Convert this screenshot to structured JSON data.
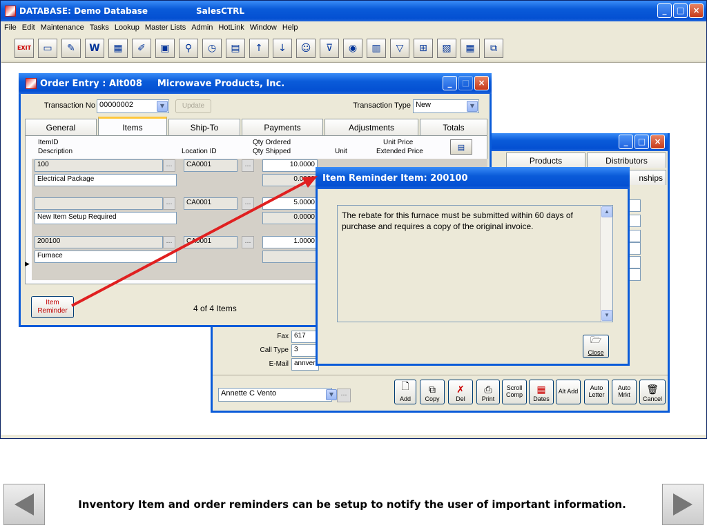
{
  "app": {
    "title_prefix": "DATABASE:",
    "db_name": "Demo Database",
    "product": "SalesCTRL"
  },
  "menu": [
    "File",
    "Edit",
    "Maintenance",
    "Tasks",
    "Lookup",
    "Master Lists",
    "Admin",
    "HotLink",
    "Window",
    "Help"
  ],
  "toolbar_exit_label": "EXIT",
  "customer_window": {
    "tabs": [
      "Products",
      "Distributors"
    ],
    "subtab_fragment": "nships",
    "fax_label": "Fax",
    "fax_value": "617",
    "calltype_label": "Call Type",
    "calltype_value": "3",
    "email_label": "E-Mail",
    "email_value": "annver",
    "contact_value": "Annette C Vento",
    "buttons": [
      {
        "name": "add",
        "label": "Add"
      },
      {
        "name": "copy",
        "label": "Copy"
      },
      {
        "name": "del",
        "label": "Del"
      },
      {
        "name": "print",
        "label": "Print"
      },
      {
        "name": "scroll-comp",
        "label": "Scroll Comp"
      },
      {
        "name": "dates",
        "label": "Dates"
      },
      {
        "name": "alt-add",
        "label": "Alt Add"
      },
      {
        "name": "auto-letter",
        "label": "Auto Letter"
      },
      {
        "name": "auto-mrkt",
        "label": "Auto Mrkt"
      },
      {
        "name": "cancel",
        "label": "Cancel"
      }
    ]
  },
  "order_entry": {
    "title": "Order Entry : Alt008",
    "company": "Microwave Products, Inc.",
    "transaction_no_label": "Transaction No",
    "transaction_no": "00000002",
    "update_label": "Update",
    "transaction_type_label": "Transaction Type",
    "transaction_type": "New",
    "tabs": [
      "General",
      "Items",
      "Ship-To",
      "Payments",
      "Adjustments",
      "Totals"
    ],
    "headers": {
      "itemid": "ItemID",
      "description": "Description",
      "location": "Location ID",
      "qty_ordered": "Qty Ordered",
      "qty_shipped": "Qty Shipped",
      "unit": "Unit",
      "unit_price": "Unit Price",
      "extended_price": "Extended Price"
    },
    "rows": [
      {
        "itemid": "100",
        "description": "Electrical Package",
        "location": "CA0001",
        "qty_ordered": "10.0000",
        "qty_shipped": "0.0000"
      },
      {
        "itemid": "",
        "description": "New Item Setup Required",
        "location": "CA0001",
        "qty_ordered": "5.0000",
        "qty_shipped": "0.0000"
      },
      {
        "itemid": "200100",
        "description": "Furnace",
        "location": "CA0001",
        "qty_ordered": "1.0000",
        "qty_shipped": ""
      }
    ],
    "reminder_button": "Item Reminder",
    "item_count": "4 of 4 Items"
  },
  "popup": {
    "title": "Item Reminder Item: 200100",
    "message": "The rebate for this furnace must be submitted within 60 days of purchase and requires a copy of the original invoice.",
    "close_label": "Close"
  },
  "caption": "Inventory Item and order reminders can be setup to notify the user of important information.",
  "colors": {
    "title_blue": "#0A5BD9",
    "arrow_red": "#E02020",
    "accent_red": "#C00000"
  }
}
